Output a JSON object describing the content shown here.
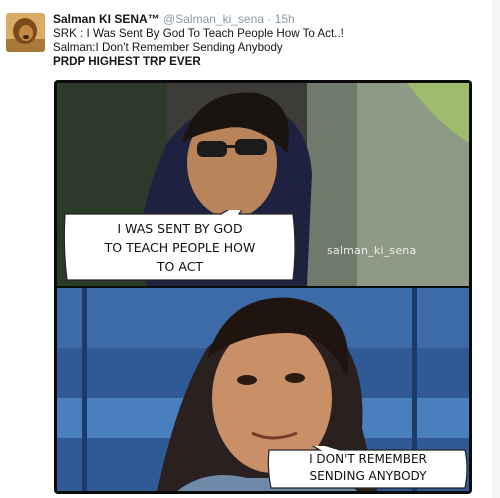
{
  "tweet": {
    "author_name": "Salman KI SENA™",
    "handle": "@Salman_ki_sena",
    "separator": "·",
    "time": "15h",
    "lines": [
      "SRK : I Was Sent By God To Teach People How To Act..!",
      "Salman:I Don't Remember Sending Anybody"
    ],
    "bold_line": "PRDP HIGHEST TRP EVER"
  },
  "media": {
    "top_panel": {
      "bubble_lines": [
        "I WAS SENT BY GOD",
        "TO TEACH PEOPLE HOW",
        "TO ACT"
      ],
      "watermark": "salman_ki_sena"
    },
    "bottom_panel": {
      "bubble_lines": [
        "I DON'T REMEMBER",
        "SENDING ANYBODY"
      ]
    }
  },
  "colors": {
    "name": "#14171a",
    "muted": "#8899a6",
    "media_border": "#0b0b0b"
  }
}
